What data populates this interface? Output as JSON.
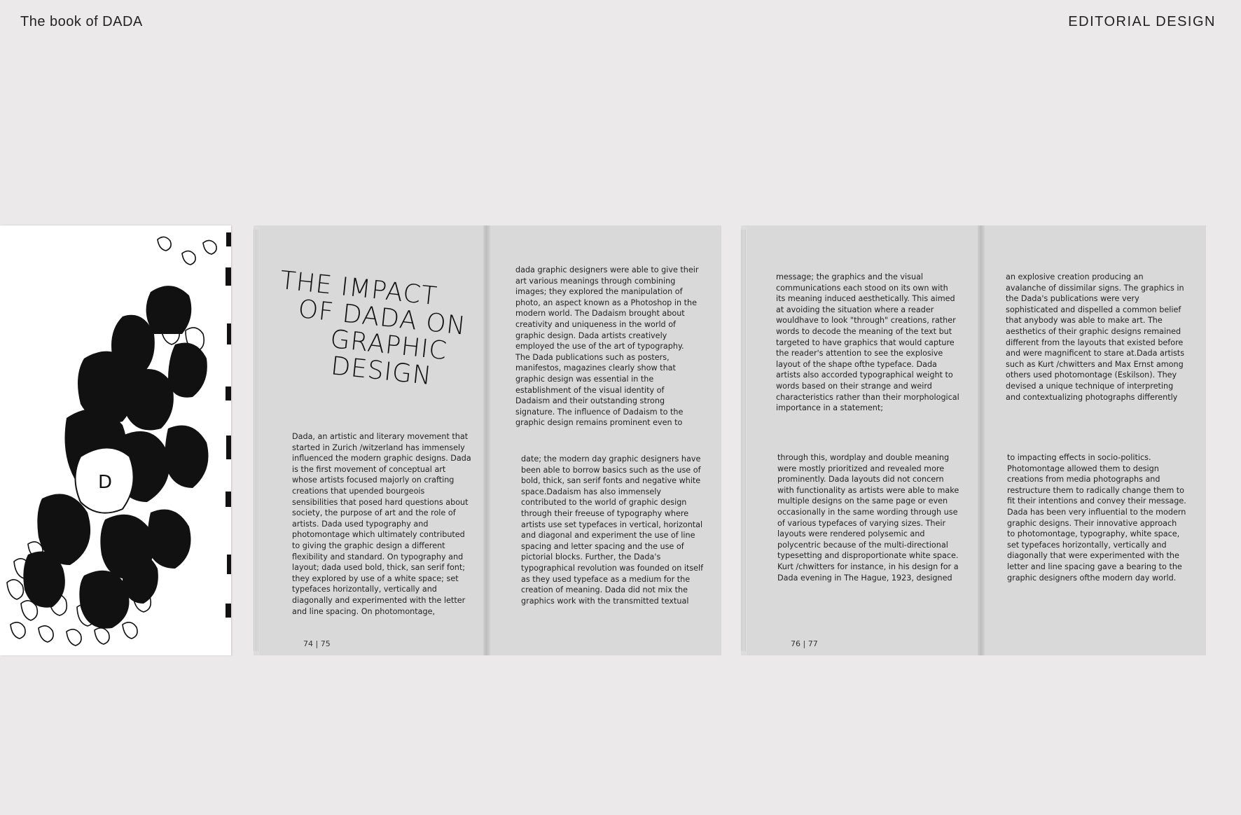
{
  "header": {
    "left_title": "The book of DADA",
    "right_title": "EDITORIAL DESIGN"
  },
  "spread1": {
    "title_lines": [
      "THE IMPACT",
      "OF DADA ON",
      "GRAPHIC",
      "DESIGN"
    ],
    "left_col": "Dada, an artistic and literary movement that started in Zurich /witzerland has immensely influenced the modern graphic designs. Dada is the first movement of conceptual art whose artists focused majorly on crafting creations that upended bourgeois sensibilities that posed hard questions about society, the purpose of art and the role of artists. Dada used typography and photomontage which ultimately contributed to giving the graphic design a different flexibility and standard. On typography and layout; dada used bold, thick, san serif font; they explored by use of a white space; set typefaces horizontally, vertically and diagonally and experimented with the letter and line spacing. On photomontage,",
    "right_top": "dada graphic designers were able to give their art various meanings through combining images; they explored the manipulation of photo, an aspect known as a Photoshop in the modern world. The Dadaism brought about creativity and uniqueness in the world of graphic design. Dada artists creatively employed the use of the art of typography. The Dada publications such as posters, manifestos, magazines clearly show that graphic design was essential in the establishment of the visual identity of Dadaism and their outstanding strong signature. The influence of Dadaism to the graphic design remains prominent even to",
    "right_bottom": "date; the modern day graphic designers have been able to borrow basics such as the use of bold, thick, san serif fonts and negative white space.Dadaism has also immensely contributed to the world of graphic design through their freeuse of typography where artists use set typefaces in vertical, horizontal and diagonal and experiment the use of line spacing and letter spacing and the use of pictorial blocks. Further, the Dada's typographical revolution was founded on itself as they used typeface as a medium for the creation of meaning. Dada did not mix the graphics work with the transmitted textual",
    "folio": "74 | 75"
  },
  "spread2": {
    "left_top": "message; the graphics and the visual communications each stood on its own with its meaning induced aesthetically. This aimed at avoiding the situation where a reader wouldhave to look \"through\" creations, rather words to decode the meaning of the text but targeted to have graphics that would capture the reader's attention to see the explosive layout of the shape ofthe typeface. Dada artists also accorded typographical weight to words based on their strange and weird characteristics rather than their morphological importance in a statement;",
    "left_bottom": "through this, wordplay and double meaning were mostly prioritized and revealed more prominently. Dada layouts did not concern with functionality as artists were able to make multiple designs on the same page or even occasionally in the same wording through use of various typefaces of varying sizes. Their layouts were rendered polysemic and polycentric because of the multi-directional typesetting and disproportionate white space. Kurt /chwitters for instance, in his design for a Dada evening in The Hague, 1923, designed",
    "right_top": "an explosive creation producing an avalanche of dissimilar signs. The graphics in the Dada's publications were very sophisticated and dispelled a common belief that anybody was able to make art. The aesthetics of their graphic designs remained different from the layouts that existed before and were magnificent to stare at.Dada artists such as Kurt /chwitters and Max Ernst among others used photomontage (Eskilson). They devised a unique technique of interpreting and contextualizing photographs differently",
    "right_bottom": "to impacting effects in socio-politics. Photomontage allowed them to design creations from media photographs and restructure them to radically change them to fit their intentions and convey their message. Dada has been very influential to the modern graphic designs. Their innovative approach to photomontage, typography, white space, set typefaces horizontally, vertically and diagonally that were experimented with the letter and line spacing gave a bearing to the graphic designers ofthe modern day world.",
    "folio": "76 | 77"
  }
}
